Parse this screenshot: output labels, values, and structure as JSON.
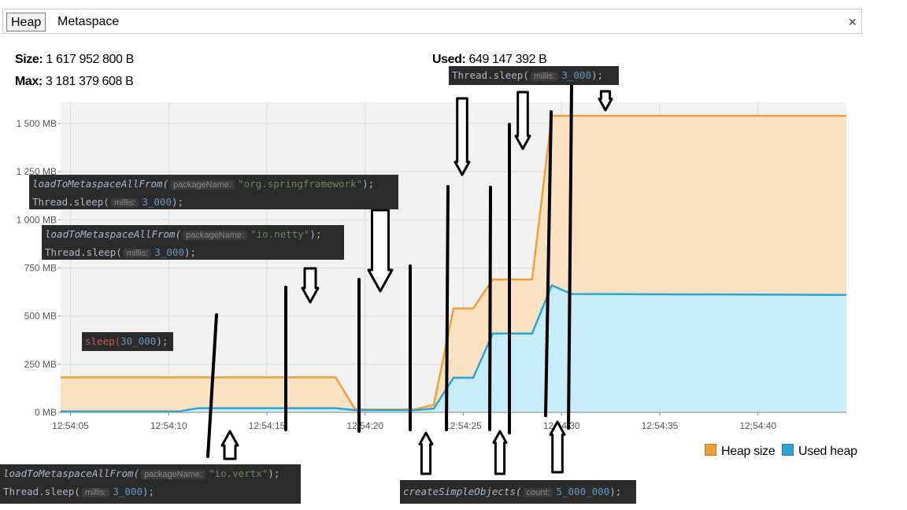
{
  "tabs": [
    {
      "label": "Heap",
      "active": true
    },
    {
      "label": "Metaspace",
      "active": false
    }
  ],
  "close_icon": "×",
  "info": {
    "size_label": "Size:",
    "size_value": "1 617 952 800 B",
    "max_label": "Max:",
    "max_value": "3 181 379 608 B",
    "used_label": "Used:",
    "used_value": "649 147 392 B"
  },
  "colors": {
    "heap": "#f0a035",
    "used": "#2aa6d4",
    "heap_fill": "#fbe2c2",
    "used_fill": "#c8ecf8",
    "plot_bg": "#f2f2f2"
  },
  "chart_data": {
    "type": "area",
    "y_unit": "MB",
    "ylim": [
      0,
      1610
    ],
    "xlim_seconds": [
      4.5,
      44.5
    ],
    "x_ticks": [
      "12:54:05",
      "12:54:10",
      "12:54:15",
      "12:54:20",
      "12:54:25",
      "12:54:30",
      "12:54:35",
      "12:54:40"
    ],
    "y_ticks": [
      "0 MB",
      "250 MB",
      "500 MB",
      "750 MB",
      "1 000 MB",
      "1 250 MB",
      "1 500 MB"
    ],
    "y_tick_values": [
      0,
      250,
      500,
      750,
      1000,
      1250,
      1500
    ],
    "grid": true,
    "legend_position": "bottom-right",
    "series": [
      {
        "name": "Heap size",
        "x": [
          4.5,
          18.5,
          19.5,
          22.5,
          23.5,
          24.5,
          25.5,
          26.5,
          27.5,
          28.5,
          29.5,
          44.5
        ],
        "y": [
          182,
          182,
          15,
          15,
          40,
          540,
          540,
          690,
          690,
          690,
          1540,
          1540
        ]
      },
      {
        "name": "Used heap",
        "x": [
          4.5,
          10.5,
          11.5,
          15.5,
          18.5,
          19.5,
          22.5,
          23.5,
          24.5,
          25.5,
          26.5,
          27.5,
          28.5,
          29.5,
          30.5,
          44.5
        ],
        "y": [
          5,
          5,
          22,
          22,
          22,
          12,
          12,
          20,
          180,
          180,
          410,
          410,
          410,
          660,
          615,
          610
        ]
      }
    ]
  },
  "annotations": {
    "vertx_fn": "loadToMetaspaceAllFrom(",
    "vertx_hint": "packageName:",
    "vertx_arg": "\"io.vertx\"",
    "vertx_end": ");",
    "vertx_sleep": "Thread.sleep(",
    "vertx_sleep_hint": "millis:",
    "vertx_sleep_arg": "3_000",
    "vertx_sleep_end": ");",
    "spring_fn": "loadToMetaspaceAllFrom(",
    "spring_hint": "packageName:",
    "spring_arg": "\"org.springframework\"",
    "spring_end": ");",
    "spring_sleep": "Thread.sleep(",
    "spring_sleep_hint": "millis:",
    "spring_sleep_arg": "3_000",
    "spring_sleep_end": ");",
    "netty_fn": "loadToMetaspaceAllFrom(",
    "netty_hint": "packageName:",
    "netty_arg": "\"io.netty\"",
    "netty_end": ");",
    "netty_sleep": "Thread.sleep(",
    "netty_sleep_hint": "millis:",
    "netty_sleep_arg": "3_000",
    "netty_sleep_end": ");",
    "sleep_fn": "sleep(",
    "sleep_arg": "30_000",
    "sleep_end": ");",
    "top_sleep": "Thread.sleep(",
    "top_sleep_hint": "millis:",
    "top_sleep_arg": "3_000",
    "top_sleep_end": ");",
    "create_fn": "createSimpleObjects(",
    "create_hint": "count:",
    "create_arg": "5_000_000",
    "create_end": ");"
  }
}
